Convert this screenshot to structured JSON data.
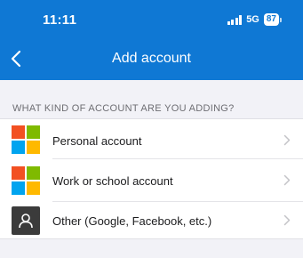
{
  "status_bar": {
    "time": "11:11",
    "network": "5G",
    "battery": "87"
  },
  "nav": {
    "title": "Add account"
  },
  "section": {
    "header": "WHAT KIND OF ACCOUNT ARE YOU ADDING?"
  },
  "accounts": [
    {
      "label": "Personal account",
      "icon": "microsoft-logo-icon"
    },
    {
      "label": "Work or school account",
      "icon": "microsoft-logo-icon"
    },
    {
      "label": "Other (Google, Facebook, etc.)",
      "icon": "generic-account-icon"
    }
  ],
  "colors": {
    "brand_blue": "#0f78d4",
    "ms_red": "#f25022",
    "ms_green": "#7fba00",
    "ms_blue": "#00a4ef",
    "ms_yellow": "#ffb900"
  }
}
